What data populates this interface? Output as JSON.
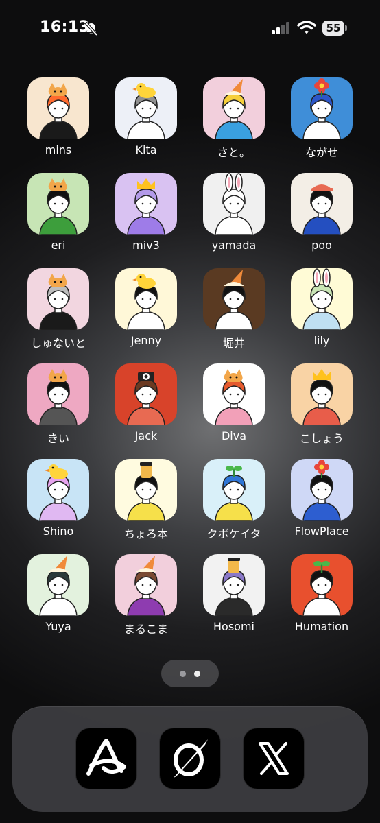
{
  "status_bar": {
    "time": "16:13",
    "battery": "55"
  },
  "page_indicator": {
    "pages": 2,
    "current": 2
  },
  "apps": [
    {
      "label": "mins",
      "bg": "#f8e6cf",
      "hair": "#ff6a2e",
      "shirt": "#1a1a1a",
      "acc": "cat"
    },
    {
      "label": "Kita",
      "bg": "#edf0f7",
      "hair": "#8f8f8f",
      "shirt": "#ffffff",
      "acc": "duck"
    },
    {
      "label": "さと。",
      "bg": "#f2cfdc",
      "hair": "#f6cf3a",
      "shirt": "#3aa0e0",
      "acc": "cone"
    },
    {
      "label": "ながせ",
      "bg": "#3f8ed8",
      "hair": "#2c56c8",
      "shirt": "#ffffff",
      "acc": "flower"
    },
    {
      "label": "eri",
      "bg": "#c7e5b5",
      "hair": "#111111",
      "shirt": "#3d9e3c",
      "acc": "cat"
    },
    {
      "label": "miv3",
      "bg": "#d9c2f2",
      "hair": "#b39ae8",
      "shirt": "#9e7ce8",
      "acc": "crown"
    },
    {
      "label": "yamada",
      "bg": "#f0f0f0",
      "hair": "#ffffff",
      "shirt": "#ffffff",
      "acc": "bunny"
    },
    {
      "label": "poo",
      "bg": "#f3eee6",
      "hair": "#111111",
      "shirt": "#244fc0",
      "acc": "cap"
    },
    {
      "label": "しゅないと",
      "bg": "#f2d6e0",
      "hair": "#bdbdbd",
      "shirt": "#1a1a1a",
      "acc": "cat"
    },
    {
      "label": "Jenny",
      "bg": "#fff8d8",
      "hair": "#111111",
      "shirt": "#ffffff",
      "acc": "duck"
    },
    {
      "label": "堀井",
      "bg": "#5a3a22",
      "hair": "#111111",
      "shirt": "#ffffff",
      "acc": "cone"
    },
    {
      "label": "lily",
      "bg": "#fffbd6",
      "hair": "#c9e5b5",
      "shirt": "#bfe0f2",
      "acc": "bunny"
    },
    {
      "label": "きい",
      "bg": "#eea8c2",
      "hair": "#111111",
      "shirt": "#555555",
      "acc": "cat"
    },
    {
      "label": "Jack",
      "bg": "#d8432a",
      "hair": "#6b3a22",
      "shirt": "#e86a52",
      "acc": "camera"
    },
    {
      "label": "Diva",
      "bg": "#ffffff",
      "hair": "#e55a2e",
      "shirt": "#f2a0b8",
      "acc": "cat"
    },
    {
      "label": "こしょう",
      "bg": "#f9d3a5",
      "hair": "#111111",
      "shirt": "#e85d4a",
      "acc": "crown"
    },
    {
      "label": "Shino",
      "bg": "#c8e4f6",
      "hair": "#e6a4ee",
      "shirt": "#e0b8f2",
      "acc": "duck"
    },
    {
      "label": "ちょろ本",
      "bg": "#fffbe0",
      "hair": "#111111",
      "shirt": "#f6e04a",
      "acc": "jar"
    },
    {
      "label": "クボケイタ",
      "bg": "#d9f0f9",
      "hair": "#2f76d6",
      "shirt": "#f6e04a",
      "acc": "sprout"
    },
    {
      "label": "FlowPlace",
      "bg": "#cfd8f6",
      "hair": "#111111",
      "shirt": "#2d5ed0",
      "acc": "flower"
    },
    {
      "label": "Yuya",
      "bg": "#e3f2de",
      "hair": "#2b3a3a",
      "shirt": "#ffffff",
      "acc": "cone"
    },
    {
      "label": "まるこま",
      "bg": "#f2cfdc",
      "hair": "#7a4a32",
      "shirt": "#8e3cb0",
      "acc": "cone"
    },
    {
      "label": "Hosomi",
      "bg": "#f2f2f2",
      "hair": "#8a78c8",
      "shirt": "#2a2a2a",
      "acc": "jar"
    },
    {
      "label": "Humation",
      "bg": "#e8502e",
      "hair": "#111111",
      "shirt": "#ffffff",
      "acc": "sprout"
    }
  ],
  "dock": [
    {
      "icon": "a-logo-icon"
    },
    {
      "icon": "slashed-circle-icon"
    },
    {
      "icon": "x-logo-icon"
    }
  ]
}
